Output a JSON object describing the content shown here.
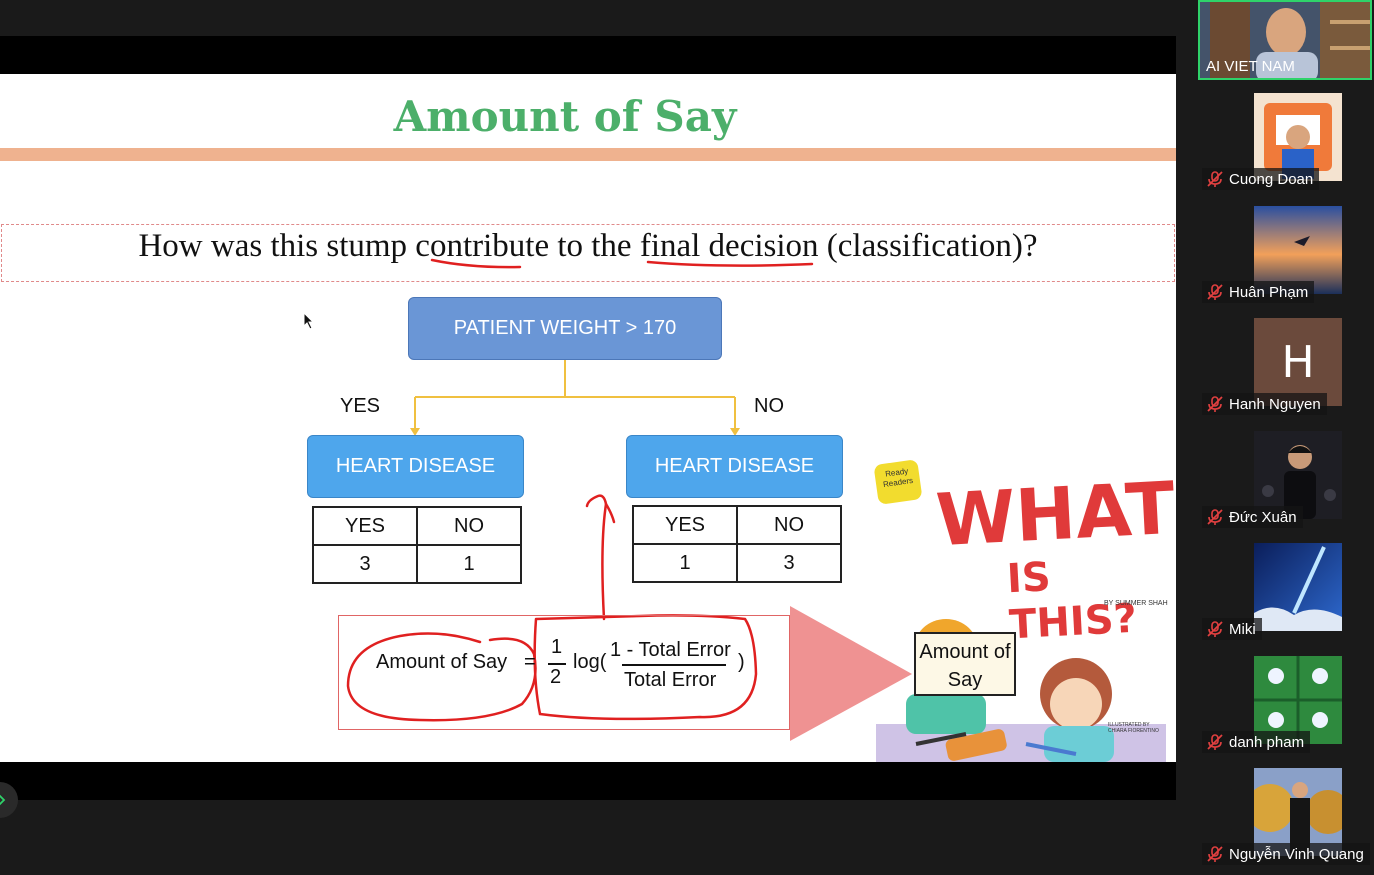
{
  "slide": {
    "title": "Amount of Say",
    "question": "How was this stump contribute to the final decision (classification)?",
    "root_node": "PATIENT WEIGHT > 170",
    "branch_yes": "YES",
    "branch_no": "NO",
    "left_leaf": "HEART DISEASE",
    "right_leaf": "HEART DISEASE",
    "left_table": {
      "headers": [
        "YES",
        "NO"
      ],
      "values": [
        "3",
        "1"
      ]
    },
    "right_table": {
      "headers": [
        "YES",
        "NO"
      ],
      "values": [
        "1",
        "3"
      ]
    },
    "formula": {
      "lhs": "Amount of Say",
      "eq": "=",
      "frac_num": "1",
      "frac_den": "2",
      "log": "log(",
      "inner_num": "1 - Total Error",
      "inner_den": "Total Error",
      "close": ")"
    },
    "book": {
      "badge": "Ready Readers",
      "title_line1": "WHAT",
      "title_line2": "IS THIS?",
      "author": "BY SUMMER SHAH",
      "illustrator": "ILLUSTRATED BY CHIARA FIORENTINO",
      "card": "Amount of Say"
    }
  },
  "participants": {
    "self": {
      "name": "AI VIET NAM"
    },
    "list": [
      {
        "name": "Cuong Doan"
      },
      {
        "name": "Huân Phạm"
      },
      {
        "name": "Hanh Nguyen",
        "initial": "H"
      },
      {
        "name": "Đức Xuân"
      },
      {
        "name": "Miki"
      },
      {
        "name": "danh pham"
      },
      {
        "name": "Nguyễn Vinh Quang"
      }
    ]
  },
  "colors": {
    "title_green": "#4caf6a",
    "band": "#efb28f",
    "root_node": "#6a96d6",
    "leaf_node": "#4ea6ec",
    "connector": "#f0c040",
    "annotation_red": "#e02020",
    "active_speaker": "#2fd36a"
  }
}
